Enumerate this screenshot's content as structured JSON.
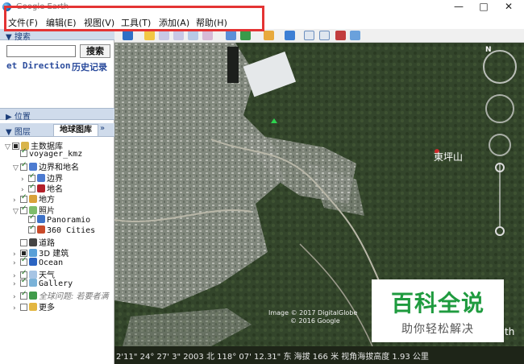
{
  "window": {
    "title": "Google Earth",
    "minimize": "—",
    "maximize": "□",
    "close": "✕"
  },
  "menu": {
    "items": [
      "文件(F)",
      "编辑(E)",
      "视图(V)",
      "工具(T)",
      "添加(A)",
      "帮助(H)"
    ]
  },
  "search": {
    "title": "▼ 搜索",
    "input_value": "",
    "button_label": "搜索",
    "direction_link": "et Direction",
    "history_link": "历史记录"
  },
  "location": {
    "title": "▶ 位置"
  },
  "layers": {
    "title": "▼ 图层",
    "tab_label": "地球图库",
    "tab_arrow": "»",
    "tree": [
      {
        "label": "主数据库",
        "exp": "▽",
        "cb": "partial",
        "icon": "db-icon"
      },
      {
        "label": "voyager_kmz",
        "exp": "",
        "cb": "checked",
        "icon": ""
      },
      {
        "label": "边界和地名",
        "exp": "▽",
        "cb": "checked",
        "icon": "flag-icon"
      },
      {
        "label": "边界",
        "exp": "›",
        "cb": "checked",
        "icon": "flag-icon"
      },
      {
        "label": "地名",
        "exp": "›",
        "cb": "checked",
        "icon": "dot-icon"
      },
      {
        "label": "地方",
        "exp": "›",
        "cb": "checked",
        "icon": "place-icon"
      },
      {
        "label": "照片",
        "exp": "▽",
        "cb": "checked",
        "icon": "photo-icon"
      },
      {
        "label": "Panoramio",
        "exp": "",
        "cb": "checked",
        "icon": "panoramio-icon"
      },
      {
        "label": "360 Cities",
        "exp": "",
        "cb": "checked",
        "icon": "cities-icon"
      },
      {
        "label": "道路",
        "exp": "",
        "cb": "none",
        "icon": "road-icon"
      },
      {
        "label": "3D 建筑",
        "exp": "›",
        "cb": "partial",
        "icon": "building-icon"
      },
      {
        "label": "Ocean",
        "exp": "›",
        "cb": "checked",
        "icon": "ocean-icon"
      },
      {
        "label": "天气",
        "exp": "›",
        "cb": "checked",
        "icon": "weather-icon"
      },
      {
        "label": "Gallery",
        "exp": "›",
        "cb": "checked",
        "icon": "gallery-icon"
      },
      {
        "label": "全球问题: 若要者满",
        "exp": "›",
        "cb": "checked",
        "icon": "globe-icon"
      },
      {
        "label": "更多",
        "exp": "›",
        "cb": "none",
        "icon": "folder-icon"
      }
    ]
  },
  "map": {
    "place_label": "東坪山",
    "attribution_1": "Image © 2017 DigitalGlobe",
    "attribution_2": "© 2016 Google",
    "compass_n": "N"
  },
  "status": {
    "text": "2'11\"  24° 27' 3\" 2003 北 118° 07' 12.31\" 东 海拔    166 米   视角海拔高度   1.93 公里"
  },
  "watermark": {
    "title": "百科全说",
    "subtitle": "助你轻松解决",
    "trailing": "th"
  },
  "colors": {
    "highlight": "#e43434",
    "watermark_green": "#1f9b3f",
    "panel_header": "#cfdbeb"
  }
}
